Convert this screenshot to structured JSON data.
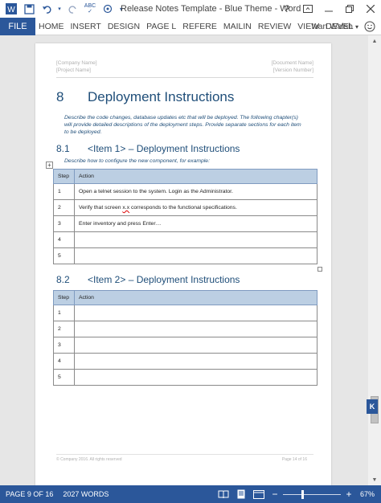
{
  "window": {
    "title": "Release Notes Template - Blue Theme - Word",
    "help": "?",
    "user": "Ivan Walsh"
  },
  "qat": {
    "touch_label": "ABC"
  },
  "ribbon": {
    "tabs": [
      "FILE",
      "HOME",
      "INSERT",
      "DESIGN",
      "PAGE L",
      "REFERE",
      "MAILIN",
      "REVIEW",
      "VIEW",
      "DEVEL"
    ]
  },
  "document": {
    "header": {
      "company_name": "[Company Name]",
      "project_name": "[Project Name]",
      "document_name": "[Document Name]",
      "version_number": "[Version Number]"
    },
    "section": {
      "number": "8",
      "title": "Deployment Instructions",
      "intro": "Describe the code changes, database updates etc that will be deployed. The following chapter(s) will provide detailed descriptions of the deployment steps. Provide separate sections for each item to be deployed."
    },
    "subsections": [
      {
        "number": "8.1",
        "title": "<Item 1> – Deployment Instructions",
        "note": "Describe how to configure the new component, for example:",
        "columns": [
          "Step",
          "Action"
        ],
        "rows": [
          [
            "1",
            "Open a telnet session to the system. Login as the Administrator."
          ],
          [
            "2",
            "Verify that screen x.x corresponds to the functional specifications."
          ],
          [
            "3",
            "Enter inventory and press Enter…"
          ],
          [
            "4",
            ""
          ],
          [
            "5",
            ""
          ]
        ]
      },
      {
        "number": "8.2",
        "title": "<Item 2> – Deployment Instructions",
        "columns": [
          "Step",
          "Action"
        ],
        "rows": [
          [
            "1",
            ""
          ],
          [
            "2",
            ""
          ],
          [
            "3",
            ""
          ],
          [
            "4",
            ""
          ],
          [
            "5",
            ""
          ]
        ]
      }
    ],
    "footer": {
      "left": "© Company 2016. All rights reserved",
      "right": "Page 14 of 16"
    }
  },
  "statusbar": {
    "page": "PAGE 9 OF 16",
    "words": "2027 WORDS",
    "zoom": "67%",
    "zoom_fraction": 0.67
  },
  "colors": {
    "brand_blue": "#2b579a",
    "heading_blue": "#1f4e79",
    "table_header": "#bccfe3"
  }
}
